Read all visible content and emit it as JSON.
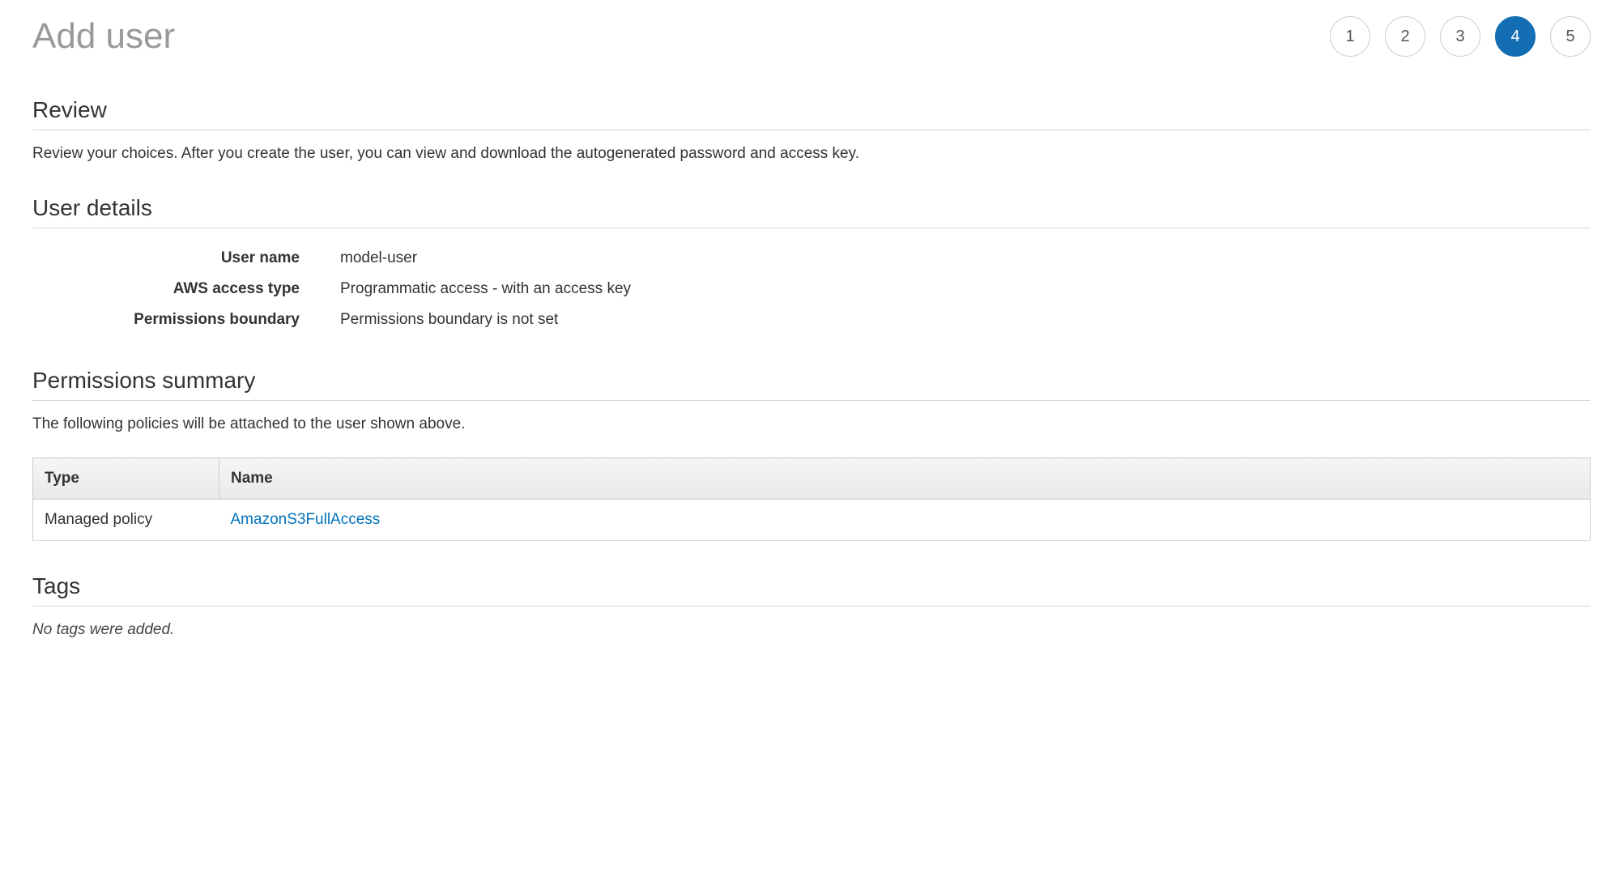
{
  "header": {
    "title": "Add user",
    "steps": [
      "1",
      "2",
      "3",
      "4",
      "5"
    ],
    "active_step_index": 3
  },
  "review": {
    "heading": "Review",
    "description": "Review your choices. After you create the user, you can view and download the autogenerated password and access key."
  },
  "user_details": {
    "heading": "User details",
    "rows": [
      {
        "label": "User name",
        "value": "model-user"
      },
      {
        "label": "AWS access type",
        "value": "Programmatic access - with an access key"
      },
      {
        "label": "Permissions boundary",
        "value": "Permissions boundary is not set"
      }
    ]
  },
  "permissions": {
    "heading": "Permissions summary",
    "description": "The following policies will be attached to the user shown above.",
    "columns": {
      "type": "Type",
      "name": "Name"
    },
    "rows": [
      {
        "type": "Managed policy",
        "name": "AmazonS3FullAccess"
      }
    ]
  },
  "tags": {
    "heading": "Tags",
    "empty_text": "No tags were added."
  }
}
